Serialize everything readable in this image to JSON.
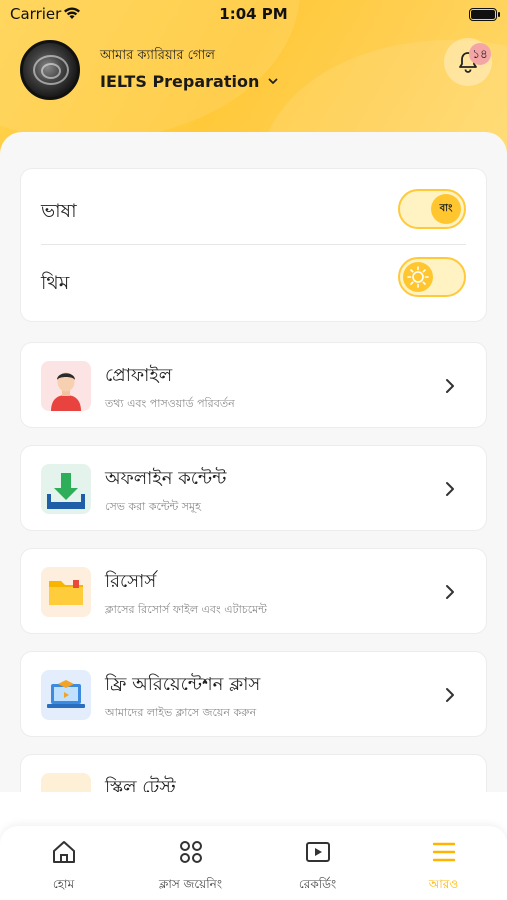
{
  "status_bar": {
    "carrier": "Carrier",
    "time": "1:04 PM"
  },
  "header": {
    "goal_label": "আমার ক্যারিয়ার গোল",
    "course_name": "IELTS Preparation",
    "notification_count": "১৪"
  },
  "settings": {
    "language": {
      "label": "ভাষা",
      "toggle_text": "বাং"
    },
    "theme": {
      "label": "থিম"
    }
  },
  "menu": [
    {
      "title": "প্রোফাইল",
      "subtitle": "তথ্য এবং পাসওয়ার্ড পরিবর্তন",
      "icon": "profile-icon"
    },
    {
      "title": "অফলাইন কন্টেন্ট",
      "subtitle": "সেভ করা কন্টেন্ট সমূহ",
      "icon": "download-icon"
    },
    {
      "title": "রিসোর্স",
      "subtitle": "ক্লাসের রিসোর্স ফাইল এবং এটাচমেন্ট",
      "icon": "folder-icon"
    },
    {
      "title": "ফ্রি অরিয়েন্টেশন ক্লাস",
      "subtitle": "আমাদের লাইভ ক্লাসে জয়েন করুন",
      "icon": "live-class-icon"
    },
    {
      "title": "স্কিল টেস্ট",
      "subtitle": "",
      "icon": "skill-test-icon"
    }
  ],
  "tabs": [
    {
      "label": "হোম",
      "icon": "home-icon",
      "active": false
    },
    {
      "label": "ক্লাস জয়েনিং",
      "icon": "grid-circles-icon",
      "active": false
    },
    {
      "label": "রেকর্ডিং",
      "icon": "play-icon",
      "active": false
    },
    {
      "label": "আরও",
      "icon": "menu-icon",
      "active": true
    }
  ],
  "colors": {
    "accent": "#ffc62f",
    "accent_text": "#ffb400",
    "background": "#f7f7f7"
  }
}
